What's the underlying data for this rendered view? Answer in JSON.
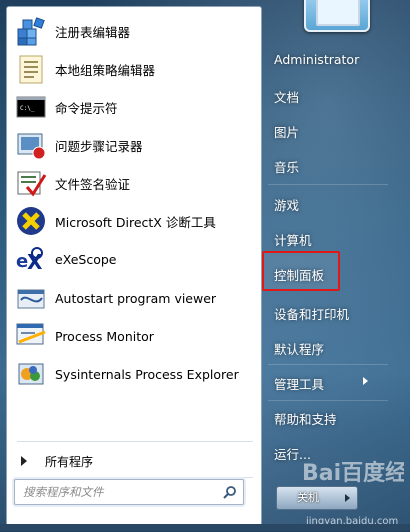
{
  "programs": [
    {
      "label": "注册表编辑器",
      "icon": "registry-editor-icon"
    },
    {
      "label": "本地组策略编辑器",
      "icon": "group-policy-icon"
    },
    {
      "label": "命令提示符",
      "icon": "command-prompt-icon"
    },
    {
      "label": "问题步骤记录器",
      "icon": "steps-recorder-icon"
    },
    {
      "label": "文件签名验证",
      "icon": "file-signature-icon"
    },
    {
      "label": "Microsoft DirectX 诊断工具",
      "icon": "directx-icon"
    },
    {
      "label": "eXeScope",
      "icon": "exescope-icon"
    },
    {
      "label": "Autostart program viewer",
      "icon": "autostart-icon"
    },
    {
      "label": "Process Monitor",
      "icon": "process-monitor-icon"
    },
    {
      "label": "Sysinternals Process Explorer",
      "icon": "process-explorer-icon"
    }
  ],
  "all_programs": "所有程序",
  "search": {
    "placeholder": "搜索程序和文件"
  },
  "right_pane": {
    "user": "Administrator",
    "items": [
      {
        "label": "文档"
      },
      {
        "label": "图片"
      },
      {
        "label": "音乐"
      },
      {
        "label": "游戏"
      },
      {
        "label": "计算机"
      },
      {
        "label": "控制面板"
      },
      {
        "label": "设备和打印机"
      },
      {
        "label": "默认程序"
      },
      {
        "label": "管理工具"
      },
      {
        "label": "帮助和支持"
      },
      {
        "label": "运行..."
      }
    ],
    "shutdown": "关机"
  },
  "watermark": {
    "text": "Bai百度经验",
    "url": "jingyan.baidu.com"
  },
  "colors": {
    "highlight": "#e01818",
    "pane_bg": "#ffffff"
  }
}
